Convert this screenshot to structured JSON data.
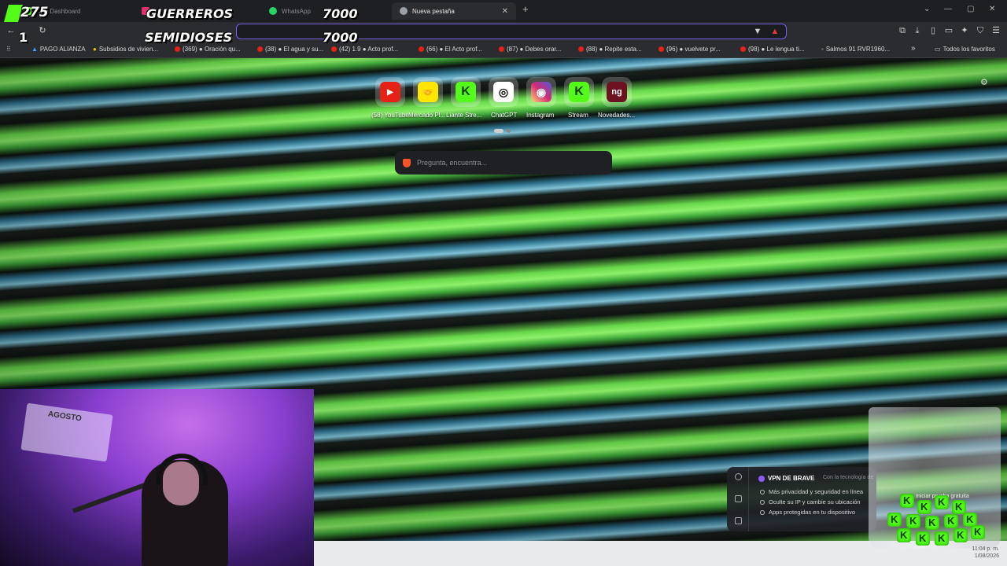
{
  "tabs": [
    {
      "label": "Kick Dashboard",
      "color": "#53fc18"
    },
    {
      "label": "",
      "color": "#e1306c"
    },
    {
      "label": "WhatsApp",
      "color": "#25d366"
    },
    {
      "label": "Nueva pestaña",
      "color": "#9aa0a6",
      "active": true
    }
  ],
  "tab_new": "+",
  "window_controls": {
    "minimize": "—",
    "maximize": "▢",
    "close": "✕",
    "dropdown": "⌄"
  },
  "overlay": {
    "score1": "275",
    "team1": "GUERREROS",
    "points1": "7000",
    "count2": "1",
    "team2": "SEMIDIOSES",
    "points2": "7000"
  },
  "bookmarks": [
    {
      "label": "PAGO ALIANZA",
      "icon": "alianza-icon"
    },
    {
      "label": "Subsidios de vivien...",
      "icon": "house-icon"
    },
    {
      "label": "(369) ● Oración qu...",
      "icon": "youtube-icon"
    },
    {
      "label": "(38) ● El agua y su...",
      "icon": "youtube-icon"
    },
    {
      "label": "(42) 1.9 ● Acto prof...",
      "icon": "youtube-icon"
    },
    {
      "label": "(66) ● El Acto prof...",
      "icon": "youtube-icon"
    },
    {
      "label": "(87) ● Debes orar...",
      "icon": "youtube-icon"
    },
    {
      "label": "(88) ● Repite esta...",
      "icon": "youtube-icon"
    },
    {
      "label": "(96) ● vuelvete pr...",
      "icon": "youtube-icon"
    },
    {
      "label": "(98) ● Le lengua ti...",
      "icon": "youtube-icon"
    },
    {
      "label": "Salmos 91 RVR1960...",
      "icon": "book-icon"
    }
  ],
  "bookmarks_more": "»",
  "all_favorites": "Todos los favoritos",
  "top_sites": [
    {
      "label": "(58) YouTube",
      "letter": "▶",
      "color": "#e62117"
    },
    {
      "label": "Mercado Pl...",
      "letter": "🤝",
      "color": "#ffe600"
    },
    {
      "label": "Liante Stre...",
      "letter": "K",
      "color": "#53fc18"
    },
    {
      "label": "ChatGPT",
      "letter": "◎",
      "color": "#ffffff"
    },
    {
      "label": "Instagram",
      "letter": "◉",
      "color": "#d6249f"
    },
    {
      "label": "Stream",
      "letter": "K",
      "color": "#53fc18"
    },
    {
      "label": "Novedades...",
      "letter": "ng",
      "color": "#6d1220"
    }
  ],
  "search": {
    "placeholder": "Pregunta, encuentra..."
  },
  "vpn": {
    "title": "VPN DE BRAVE",
    "subtitle": "Con la tecnología de",
    "items": [
      "Más privacidad y seguridad en línea",
      "Oculte su IP y cambie su ubicación",
      "Apps protegidas en tu dispositivo"
    ],
    "trial": "Iniciar prueba gratuita"
  },
  "webcam": {
    "calendar": "AGOSTO"
  },
  "clock": {
    "time": "11:04 p. m.",
    "date": "1/08/2026"
  }
}
